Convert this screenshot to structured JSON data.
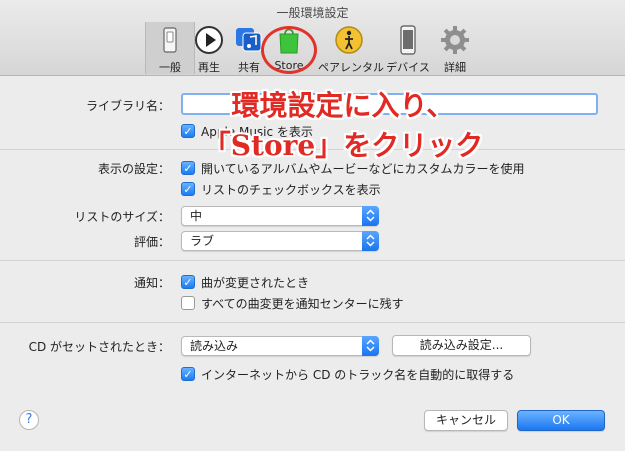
{
  "window": {
    "title": "一般環境設定"
  },
  "toolbar": {
    "items": [
      {
        "label": "一般",
        "icon": "switch-icon"
      },
      {
        "label": "再生",
        "icon": "play-icon"
      },
      {
        "label": "共有",
        "icon": "music-share-icon"
      },
      {
        "label": "Store",
        "icon": "store-bag-icon"
      },
      {
        "label": "ペアレンタル",
        "icon": "parental-icon"
      },
      {
        "label": "デバイス",
        "icon": "device-icon"
      },
      {
        "label": "詳細",
        "icon": "gear-icon"
      }
    ],
    "active": "一般"
  },
  "annotation": {
    "line1": "環境設定に入り、",
    "line2": "「Store」をクリック",
    "color": "#e02a23"
  },
  "library": {
    "label": "ライブラリ名：",
    "value": "",
    "apple_music": {
      "label": "Apple Music を表示",
      "checked": true
    }
  },
  "display": {
    "label": "表示の設定：",
    "options": [
      {
        "label": "開いているアルバムやムービーなどにカスタムカラーを使用",
        "checked": true
      },
      {
        "label": "リストのチェックボックスを表示",
        "checked": true
      }
    ]
  },
  "list_size": {
    "label": "リストのサイズ：",
    "value": "中"
  },
  "rating": {
    "label": "評価：",
    "value": "ラブ"
  },
  "notifications": {
    "label": "通知：",
    "options": [
      {
        "label": "曲が変更されたとき",
        "checked": true
      },
      {
        "label": "すべての曲変更を通知センターに残す",
        "checked": false
      }
    ]
  },
  "cd": {
    "label": "CD がセットされたとき：",
    "value": "読み込み",
    "settings_button": "読み込み設定...",
    "fetch_names": {
      "label": "インターネットから CD のトラック名を自動的に取得する",
      "checked": true
    }
  },
  "footer": {
    "help": "?",
    "cancel": "キャンセル",
    "ok": "OK"
  },
  "colors": {
    "accent": "#1b77f0",
    "annotation": "#e02a23"
  }
}
